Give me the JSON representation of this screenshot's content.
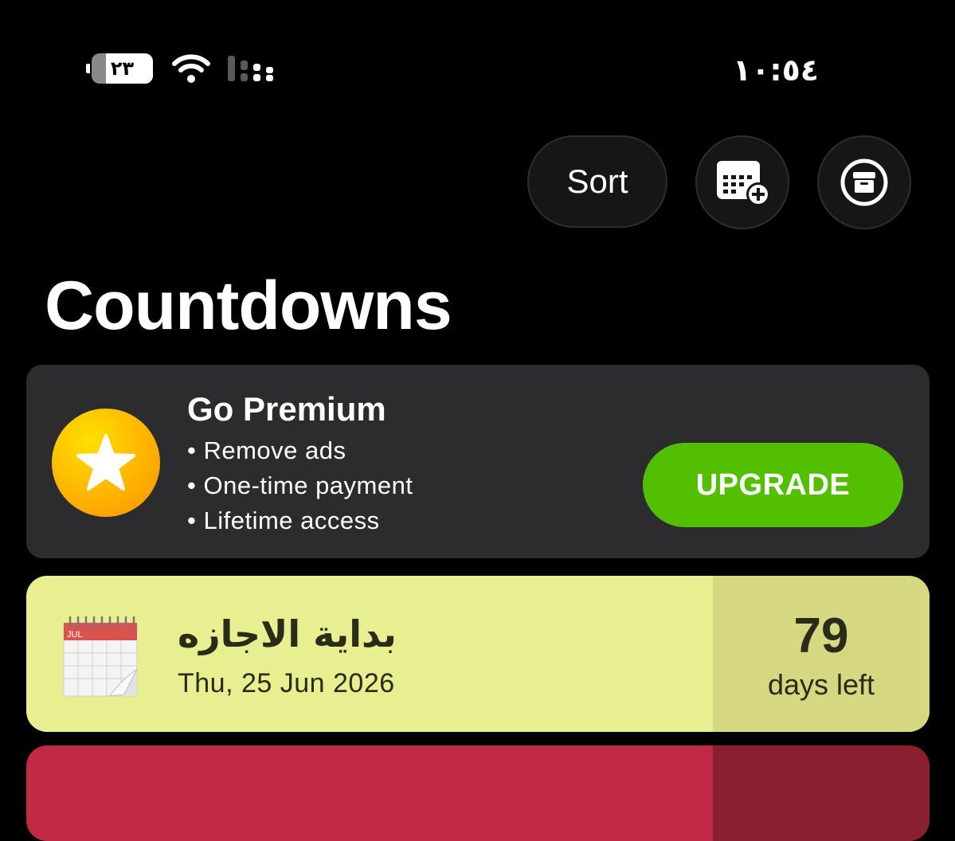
{
  "status_bar": {
    "battery_level": "٢٣",
    "battery_fraction": 0.23,
    "time": "١٠:٥٤",
    "icons": [
      "battery-icon",
      "wifi-icon",
      "cellular-signal-icon"
    ]
  },
  "toolbar": {
    "sort_label": "Sort",
    "add_icon": "calendar-add-icon",
    "archive_icon": "archive-icon"
  },
  "page_title": "Countdowns",
  "premium": {
    "title": "Go Premium",
    "benefits": [
      "Remove ads",
      "One-time payment",
      "Lifetime access"
    ],
    "upgrade_label": "UPGRADE",
    "icon": "star-icon",
    "accent": "#52c000"
  },
  "countdowns": [
    {
      "title": "بداية الاجازه",
      "date": "Thu, 25 Jun 2026",
      "days": "79",
      "unit": "days left",
      "icon": "calendar-icon",
      "icon_month": "JUL",
      "color": "#e8ef90"
    },
    {
      "color": "#c02a45"
    }
  ]
}
